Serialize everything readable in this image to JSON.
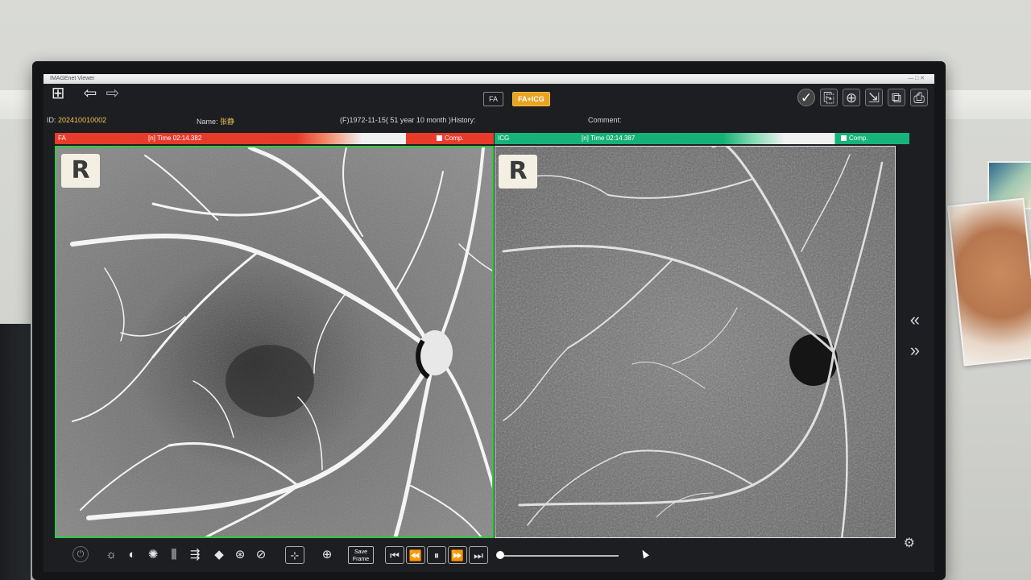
{
  "window": {
    "title": "IMAGEnet Viewer",
    "controls": "— □ ✕"
  },
  "toolbar": {
    "layout_icon": "layout-grid-icon",
    "back_icon": "arrow-left-icon",
    "forward_icon": "arrow-right-icon",
    "modes": [
      {
        "label": "FA",
        "active": false
      },
      {
        "label": "FA+ICG",
        "active": true
      }
    ]
  },
  "patient": {
    "id_label": "ID:",
    "id_value": "202410010002",
    "name_label": "Name:",
    "name_value": "张静",
    "dob": "(F)1972-11-15( 51 year 10 month )",
    "history_label": "History:",
    "comment_label": "Comment:"
  },
  "left_panel": {
    "modality": "FA",
    "time_text": "[n]  Time  02:14.382",
    "comp_label": "Comp.",
    "eye": "R",
    "accent": "#2ecc40"
  },
  "right_panel": {
    "modality": "ICG",
    "time_text": "[n]  Time  02:14.387",
    "comp_label": "Comp.",
    "eye": "R"
  },
  "controls": {
    "save_frame_line1": "Save",
    "save_frame_line2": "Frame"
  },
  "colors": {
    "fa_header": "#e93b2c",
    "icg_header": "#16b37a",
    "mode_active": "#e8a322"
  }
}
